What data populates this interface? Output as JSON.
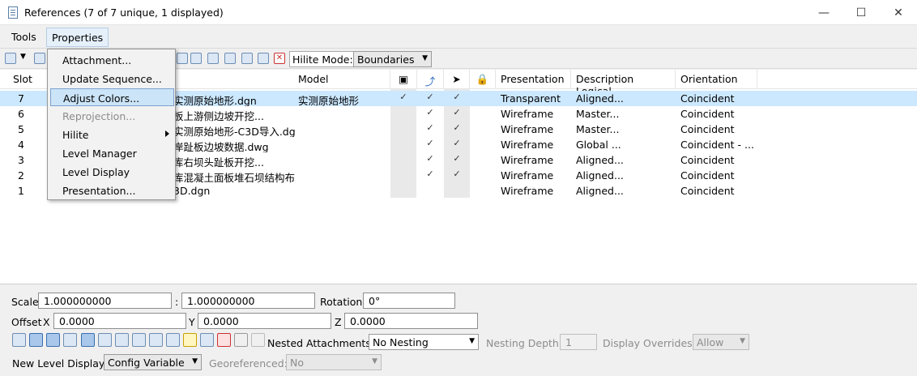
{
  "window": {
    "title": "References (7 of 7 unique, 1 displayed)",
    "minimize": "—",
    "maximize": "☐",
    "close": "✕"
  },
  "menubar": {
    "tools": "Tools",
    "properties": "Properties"
  },
  "toolbar": {
    "hilite_mode_label": "Hilite Mode:",
    "hilite_mode_value": "Boundaries"
  },
  "dropdown": {
    "items": [
      {
        "label": "Attachment..."
      },
      {
        "label": "Update Sequence..."
      },
      {
        "label": "Adjust Colors..."
      },
      {
        "label": "Reprojection..."
      },
      {
        "label": "Hilite"
      },
      {
        "label": "Level Manager"
      },
      {
        "label": "Level Display"
      },
      {
        "label": "Presentation..."
      }
    ]
  },
  "table": {
    "headers": {
      "slot": "Slot",
      "model": "Model",
      "presentation": "Presentation",
      "description_logical": "Description Logical",
      "orientation": "Orientation"
    },
    "rows": [
      {
        "slot": "7",
        "file": "实测原始地形.dgn",
        "model": "实测原始地形",
        "presentation": "Transparent",
        "description": "Aligned...",
        "orientation": "Coincident",
        "c1": "✓",
        "c2": "✓",
        "c3": "✓"
      },
      {
        "slot": "6",
        "file": "板上游侧边坡开挖...",
        "model": "",
        "presentation": "Wireframe",
        "description": "Master...",
        "orientation": "Coincident",
        "c1": "",
        "c2": "✓",
        "c3": "✓"
      },
      {
        "slot": "5",
        "file": "实测原始地形-C3D导入.dgn",
        "model": "",
        "presentation": "Wireframe",
        "description": "Master...",
        "orientation": "Coincident",
        "c1": "",
        "c2": "✓",
        "c3": "✓"
      },
      {
        "slot": "4",
        "file": "岸趾板边坡数据.dwg",
        "model": "",
        "presentation": "Wireframe",
        "description": "Global ...",
        "orientation": "Coincident - ...",
        "c1": "",
        "c2": "✓",
        "c3": "✓"
      },
      {
        "slot": "3",
        "file": "库右坝头趾板开挖...",
        "model": "",
        "presentation": "Wireframe",
        "description": "Aligned...",
        "orientation": "Coincident",
        "c1": "",
        "c2": "✓",
        "c3": "✓"
      },
      {
        "slot": "2",
        "file": "库混凝土面板堆石坝结构布置",
        "model": "",
        "presentation": "Wireframe",
        "description": "Aligned...",
        "orientation": "Coincident",
        "c1": "",
        "c2": "✓",
        "c3": "✓"
      },
      {
        "slot": "1",
        "file": "3D.dgn",
        "model": "",
        "presentation": "Wireframe",
        "description": "Aligned...",
        "orientation": "Coincident",
        "c1": "",
        "c2": "",
        "c3": ""
      }
    ]
  },
  "bottom": {
    "scale_label": "Scale",
    "scale_x": "1.000000000",
    "scale_sep": ":",
    "scale_y": "1.000000000",
    "rotation_label": "Rotation",
    "rotation_value": "0°",
    "offset_label": "Offset",
    "x_label": "X",
    "offset_x": "0.0000",
    "y_label": "Y",
    "offset_y": "0.0000",
    "z_label": "Z",
    "offset_z": "0.0000",
    "nested_label": "Nested Attachments:",
    "nested_value": "No Nesting",
    "nesting_depth_label": "Nesting Depth:",
    "nesting_depth_value": "1",
    "display_overrides_label": "Display Overrides:",
    "display_overrides_value": "Allow",
    "new_level_label": "New Level Display:",
    "new_level_value": "Config Variable",
    "georef_label": "Georeferenced:",
    "georef_value": "No"
  }
}
